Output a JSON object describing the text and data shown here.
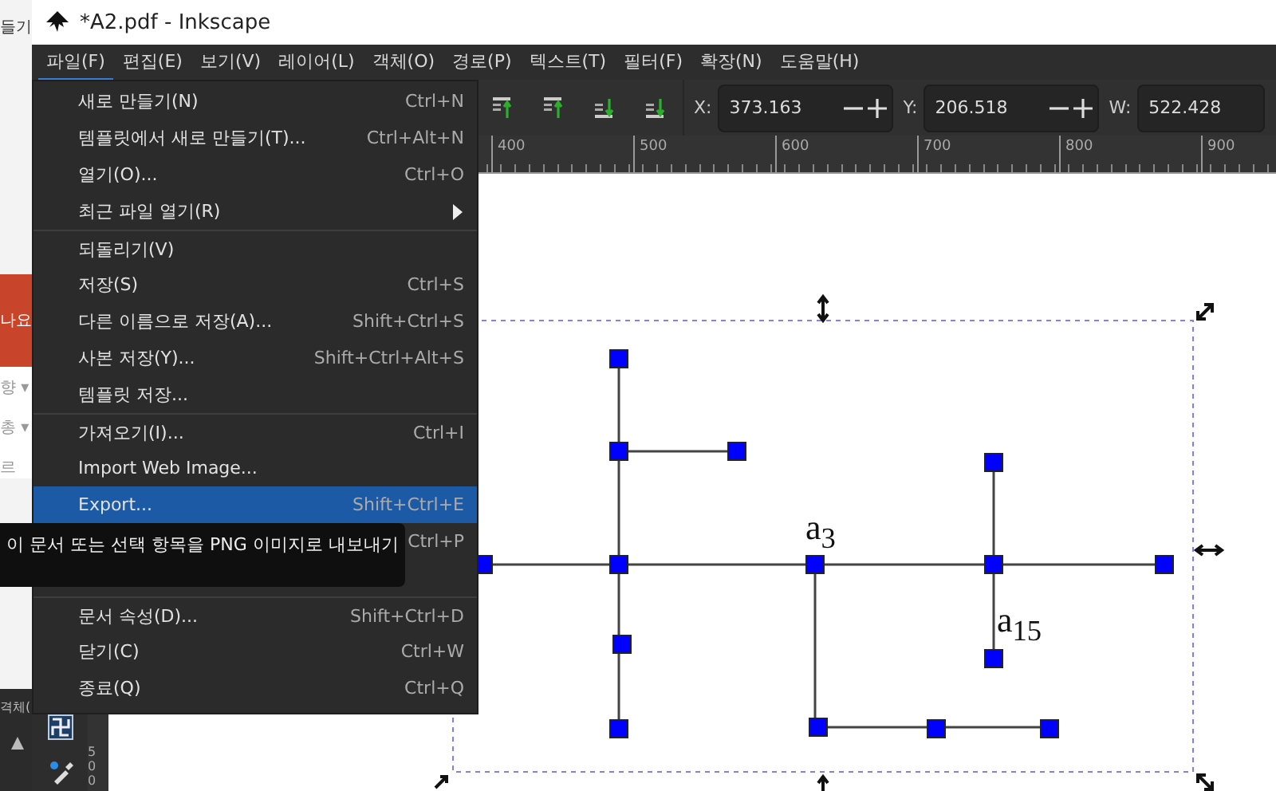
{
  "background_app": {
    "top_text": "들기",
    "band_text": "나요",
    "list_texts": [
      "향 ▾",
      "총 ▾",
      "르"
    ],
    "panel_text": "격체("
  },
  "window": {
    "title": "*A2.pdf - Inkscape"
  },
  "menubar": [
    {
      "label": "파일(F)",
      "selected": true
    },
    {
      "label": "편집(E)",
      "selected": false
    },
    {
      "label": "보기(V)",
      "selected": false
    },
    {
      "label": "레이어(L)",
      "selected": false
    },
    {
      "label": "객체(O)",
      "selected": false
    },
    {
      "label": "경로(P)",
      "selected": false
    },
    {
      "label": "텍스트(T)",
      "selected": false
    },
    {
      "label": "필터(F)",
      "selected": false
    },
    {
      "label": "확장(N)",
      "selected": false
    },
    {
      "label": "도움말(H)",
      "selected": false
    }
  ],
  "file_menu": [
    {
      "kind": "item",
      "label": "새로 만들기(N)",
      "shortcut": "Ctrl+N",
      "selected": false,
      "group_start": false
    },
    {
      "kind": "item",
      "label": "템플릿에서 새로 만들기(T)...",
      "shortcut": "Ctrl+Alt+N",
      "selected": false,
      "group_start": false
    },
    {
      "kind": "item",
      "label": "열기(O)...",
      "shortcut": "Ctrl+O",
      "selected": false,
      "group_start": false
    },
    {
      "kind": "submenu",
      "label": "최근 파일 열기(R)",
      "selected": false,
      "group_start": false
    },
    {
      "kind": "item",
      "label": "되돌리기(V)",
      "selected": false,
      "group_start": true
    },
    {
      "kind": "item",
      "label": "저장(S)",
      "shortcut": "Ctrl+S",
      "selected": false,
      "group_start": false
    },
    {
      "kind": "item",
      "label": "다른 이름으로 저장(A)...",
      "shortcut": "Shift+Ctrl+S",
      "selected": false,
      "group_start": false
    },
    {
      "kind": "item",
      "label": "사본 저장(Y)...",
      "shortcut": "Shift+Ctrl+Alt+S",
      "selected": false,
      "group_start": false
    },
    {
      "kind": "item",
      "label": "템플릿 저장...",
      "selected": false,
      "group_start": false
    },
    {
      "kind": "item",
      "label": "가져오기(I)...",
      "shortcut": "Ctrl+I",
      "selected": false,
      "group_start": true
    },
    {
      "kind": "item",
      "label": "Import Web Image...",
      "selected": false,
      "group_start": false
    },
    {
      "kind": "item",
      "label": "Export...",
      "shortcut": "Shift+Ctrl+E",
      "selected": true,
      "group_start": false
    },
    {
      "kind": "item",
      "shortcut": "Ctrl+P",
      "selected": false,
      "group_start": false
    },
    {
      "kind": "item",
      "selected": false,
      "group_start": false
    },
    {
      "kind": "item",
      "label": "문서 속성(D)...",
      "shortcut": "Shift+Ctrl+D",
      "selected": false,
      "group_start": true
    },
    {
      "kind": "item",
      "label": "닫기(C)",
      "shortcut": "Ctrl+W",
      "selected": false,
      "group_start": false
    },
    {
      "kind": "item",
      "label": "종료(Q)",
      "shortcut": "Ctrl+Q",
      "selected": false,
      "group_start": false
    }
  ],
  "tooltip": "이 문서 또는 선택 항목을 PNG 이미지로 내보내기",
  "toolbar": {
    "fields": [
      {
        "label": "X:",
        "value": "373.163",
        "stepper": true
      },
      {
        "label": "Y:",
        "value": "206.518",
        "stepper": true
      },
      {
        "label": "W:",
        "value": "522.428",
        "stepper": false
      }
    ]
  },
  "ruler": {
    "horizontal_labels": [
      "400",
      "500",
      "600",
      "700",
      "800",
      "900"
    ],
    "vertical_labels": [
      "5",
      "0",
      "0"
    ]
  },
  "canvas": {
    "labels": [
      "a$_{3}$",
      "a$_{15}$"
    ]
  }
}
